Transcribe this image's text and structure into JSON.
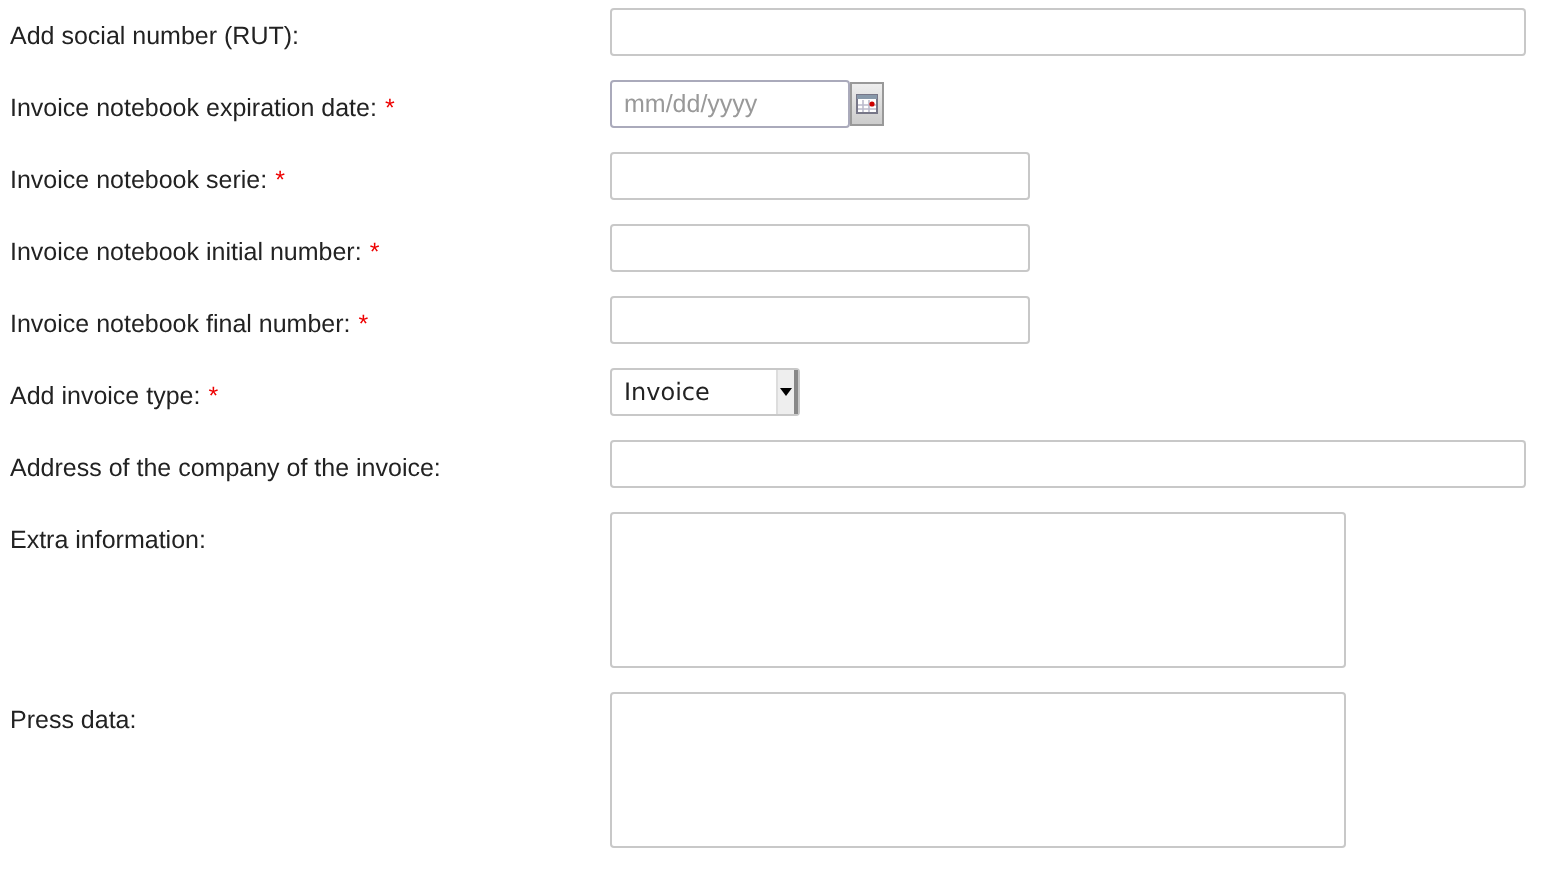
{
  "fields": [
    {
      "label": "Add social number (RUT):",
      "kind": "line"
    },
    {
      "label": "Invoice notebook expiration date:",
      "required_mark": "*",
      "kind": "date",
      "placeholder": "mm/dd/yyyy"
    },
    {
      "label": "Invoice notebook serie:",
      "required_mark": "*",
      "kind": "short"
    },
    {
      "label": "Invoice notebook initial number:",
      "required_mark": "*",
      "kind": "short"
    },
    {
      "label": "Invoice notebook final number:",
      "required_mark": "*",
      "kind": "short"
    },
    {
      "label": "Add invoice type:",
      "required_mark": "*",
      "kind": "select",
      "value": "Invoice"
    },
    {
      "label": "Address of the company of the invoice:",
      "kind": "line"
    },
    {
      "label": "Extra information:",
      "kind": "area"
    },
    {
      "label": "Press data:",
      "kind": "area"
    }
  ]
}
